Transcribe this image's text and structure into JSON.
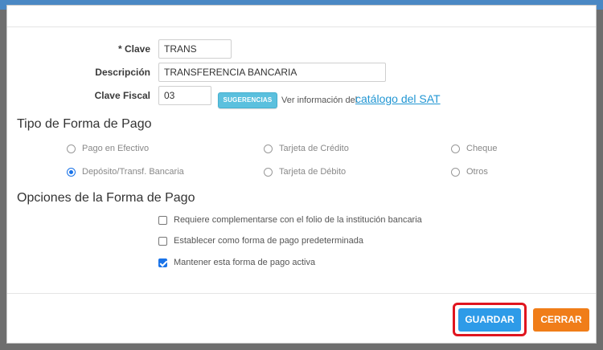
{
  "form": {
    "clave_label": "* Clave",
    "clave_value": "TRANS",
    "descripcion_label": "Descripción",
    "descripcion_value": "TRANSFERENCIA BANCARIA",
    "clave_fiscal_label": "Clave Fiscal",
    "clave_fiscal_value": "03",
    "sugerencias_label": "SUGERENCIAS",
    "sat_info_text": "Ver información del",
    "sat_link_text": "catálogo del SAT"
  },
  "tipo_forma_pago": {
    "title": "Tipo de Forma de Pago",
    "options": [
      {
        "label": "Pago en Efectivo",
        "checked": false
      },
      {
        "label": "Tarjeta de Crédito",
        "checked": false
      },
      {
        "label": "Cheque",
        "checked": false
      },
      {
        "label": "Depósito/Transf. Bancaria",
        "checked": true
      },
      {
        "label": "Tarjeta de Débito",
        "checked": false
      },
      {
        "label": "Otros",
        "checked": false
      }
    ]
  },
  "opciones": {
    "title": "Opciones de la Forma de Pago",
    "items": [
      {
        "label": "Requiere complementarse con el folio de la institución bancaria",
        "checked": false
      },
      {
        "label": "Establecer como forma de pago predeterminada",
        "checked": false
      },
      {
        "label": "Mantener esta forma de pago activa",
        "checked": true
      }
    ]
  },
  "footer": {
    "guardar_label": "GUARDAR",
    "cerrar_label": "CERRAR"
  },
  "colors": {
    "primary": "#2e9be8",
    "warning": "#f07d19",
    "info": "#5bc0de",
    "highlight": "#e0151f",
    "link": "#2196d3"
  }
}
